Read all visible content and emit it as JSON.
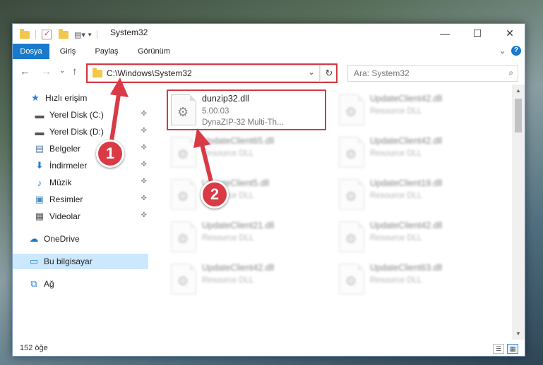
{
  "titlebar": {
    "title": "System32",
    "minimize_glyph": "—",
    "maximize_glyph": "☐",
    "close_glyph": "✕"
  },
  "ribbon": {
    "tabs": [
      {
        "label": "Dosya",
        "active": true
      },
      {
        "label": "Giriş"
      },
      {
        "label": "Paylaş"
      },
      {
        "label": "Görünüm"
      }
    ],
    "collapse_glyph": "⌄",
    "help_glyph": "?"
  },
  "address": {
    "path": "C:\\Windows\\System32",
    "dropdown_glyph": "⌄",
    "refresh_glyph": "↻"
  },
  "search": {
    "placeholder": "Ara: System32",
    "icon_glyph": "⌕"
  },
  "sidebar": {
    "items": [
      {
        "label": "Hızlı erişim",
        "icon": "star-icon",
        "glyph": "★",
        "color": "#2a7ed2"
      },
      {
        "label": "Yerel Disk (C:)",
        "icon": "drive-c-icon",
        "glyph": "▬",
        "color": "#555555",
        "pinned": true
      },
      {
        "label": "Yerel Disk (D:)",
        "icon": "drive-d-icon",
        "glyph": "▬",
        "color": "#555555",
        "pinned": true
      },
      {
        "label": "Belgeler",
        "icon": "documents-icon",
        "glyph": "▤",
        "color": "#5a7fa6",
        "pinned": true
      },
      {
        "label": "İndirmeler",
        "icon": "downloads-icon",
        "glyph": "⬇",
        "color": "#2a7ed2",
        "pinned": true
      },
      {
        "label": "Müzik",
        "icon": "music-icon",
        "glyph": "♪",
        "color": "#2a7ed2",
        "pinned": true
      },
      {
        "label": "Resimler",
        "icon": "pictures-icon",
        "glyph": "▣",
        "color": "#4a8fc9",
        "pinned": true
      },
      {
        "label": "Videolar",
        "icon": "videos-icon",
        "glyph": "▦",
        "color": "#555555",
        "pinned": true
      },
      {
        "label": "OneDrive",
        "icon": "onedrive-icon",
        "glyph": "☁",
        "color": "#1979ca"
      },
      {
        "label": "Bu bilgisayar",
        "icon": "computer-icon",
        "glyph": "▭",
        "color": "#2a7ed2",
        "selected": true
      },
      {
        "label": "Ağ",
        "icon": "network-icon",
        "glyph": "⧉",
        "color": "#2a7ed2"
      }
    ],
    "pin_glyph": "📌"
  },
  "files": [
    {
      "name": "dunzip32.dll",
      "line2": "5.00.03",
      "line3": "DynaZIP-32 Multi-Th...",
      "highlight": true
    },
    {
      "name": "UpdateClient42.dll",
      "line2": "Resource DLL"
    },
    {
      "name": "UpdateClient65.dll",
      "line2": "Resource DLL"
    },
    {
      "name": "UpdateClient42.dll",
      "line2": "Resource DLL"
    },
    {
      "name": "UpdateClient5.dll",
      "line2": "Resource DLL"
    },
    {
      "name": "UpdateClient19.dll",
      "line2": "Resource DLL"
    },
    {
      "name": "UpdateClient21.dll",
      "line2": "Resource DLL"
    },
    {
      "name": "UpdateClient42.dll",
      "line2": "Resource DLL"
    },
    {
      "name": "UpdateClient42.dll",
      "line2": "Resource DLL"
    },
    {
      "name": "UpdateClient63.dll",
      "line2": "Resource DLL"
    }
  ],
  "status": {
    "count": "152 öğe"
  },
  "callouts": [
    {
      "label": "1"
    },
    {
      "label": "2"
    }
  ],
  "colors": {
    "accent": "#1979ca",
    "highlight": "#d23a44",
    "selection": "#cce8ff"
  }
}
